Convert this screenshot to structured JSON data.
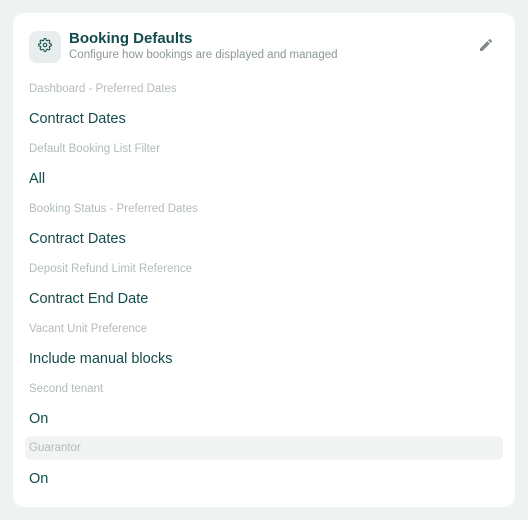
{
  "card": {
    "title": "Booking Defaults",
    "subtitle": "Configure how bookings are displayed and managed",
    "header_icon": "gear-icon",
    "edit_icon": "pencil-icon"
  },
  "fields": [
    {
      "label": "Dashboard - Preferred Dates",
      "value": "Contract Dates"
    },
    {
      "label": "Default Booking List Filter",
      "value": "All"
    },
    {
      "label": "Booking Status - Preferred Dates",
      "value": "Contract Dates"
    },
    {
      "label": "Deposit Refund Limit Reference",
      "value": "Contract End Date"
    },
    {
      "label": "Vacant Unit Preference",
      "value": "Include manual blocks"
    },
    {
      "label": "Second tenant",
      "value": "On"
    },
    {
      "label": "Guarantor",
      "value": "On"
    }
  ],
  "colors": {
    "accent": "#124c4a",
    "label": "#b2bcba",
    "background": "#eef2f1",
    "card": "#ffffff"
  }
}
